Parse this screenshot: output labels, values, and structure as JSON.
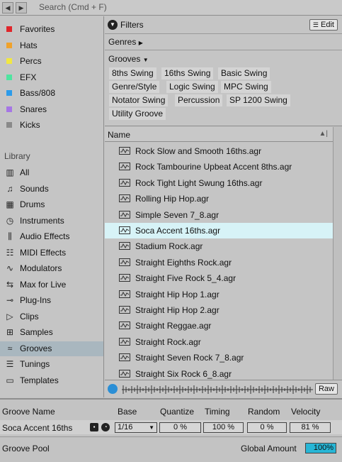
{
  "nav": {
    "back_icon": "left-arrow-icon",
    "forward_icon": "right-arrow-icon"
  },
  "search": {
    "placeholder": "Search (Cmd + F)"
  },
  "collections": [
    {
      "label": "Favorites",
      "color": "#e0262b"
    },
    {
      "label": "Hats",
      "color": "#f0a22c"
    },
    {
      "label": "Percs",
      "color": "#f1e742"
    },
    {
      "label": "EFX",
      "color": "#4fe4a0"
    },
    {
      "label": "Bass/808",
      "color": "#2c9bea"
    },
    {
      "label": "Snares",
      "color": "#a676e5"
    },
    {
      "label": "Kicks",
      "color": "#8a8a8a"
    }
  ],
  "library": {
    "heading": "Library",
    "items": [
      {
        "label": "All",
        "icon": "library-icon"
      },
      {
        "label": "Sounds",
        "icon": "note-icon"
      },
      {
        "label": "Drums",
        "icon": "drum-grid-icon"
      },
      {
        "label": "Instruments",
        "icon": "instrument-icon"
      },
      {
        "label": "Audio Effects",
        "icon": "audio-effects-icon"
      },
      {
        "label": "MIDI Effects",
        "icon": "midi-effects-icon"
      },
      {
        "label": "Modulators",
        "icon": "modulators-icon"
      },
      {
        "label": "Max for Live",
        "icon": "max-for-live-icon"
      },
      {
        "label": "Plug-Ins",
        "icon": "plugin-icon"
      },
      {
        "label": "Clips",
        "icon": "clips-icon"
      },
      {
        "label": "Samples",
        "icon": "samples-icon"
      },
      {
        "label": "Grooves",
        "icon": "grooves-icon",
        "selected": true
      },
      {
        "label": "Tunings",
        "icon": "tunings-icon"
      },
      {
        "label": "Templates",
        "icon": "templates-icon"
      }
    ]
  },
  "filters": {
    "label": "Filters",
    "edit_label": "Edit",
    "genres_label": "Genres",
    "grooves_label": "Grooves",
    "grooves_tags": [
      "8ths Swing",
      "16ths Swing",
      "Basic Swing",
      "Genre/Style",
      "Logic Swing",
      "MPC Swing",
      "Notator Swing",
      "Percussion",
      "SP 1200 Swing",
      "Utility Groove"
    ]
  },
  "list": {
    "column_name": "Name",
    "files": [
      "Rock Slow and Smooth 16ths.agr",
      "Rock Tambourine Upbeat Accent 8ths.agr",
      "Rock Tight Light Swung 16ths.agr",
      "Rolling Hip Hop.agr",
      "Simple Seven 7_8.agr",
      "Soca Accent 16ths.agr",
      "Stadium Rock.agr",
      "Straight Eighths Rock.agr",
      "Straight Five Rock 5_4.agr",
      "Straight Hip Hop 1.agr",
      "Straight Hip Hop 2.agr",
      "Straight Reggae.agr",
      "Straight Rock.agr",
      "Straight Seven Rock 7_8.agr",
      "Straight Six Rock 6_8.agr"
    ],
    "selected_file": "Soca Accent 16ths.agr",
    "raw_label": "Raw"
  },
  "pool": {
    "headers": {
      "groove_name": "Groove Name",
      "base": "Base",
      "quantize": "Quantize",
      "timing": "Timing",
      "random": "Random",
      "velocity": "Velocity"
    },
    "row": {
      "name": "Soca Accent 16ths",
      "base": "1/16",
      "quantize": "0 %",
      "timing": "100 %",
      "random": "0 %",
      "velocity": "81 %"
    },
    "title": "Groove Pool",
    "global_amount_label": "Global Amount",
    "global_amount": "100%",
    "accent": "#27b6d6"
  }
}
